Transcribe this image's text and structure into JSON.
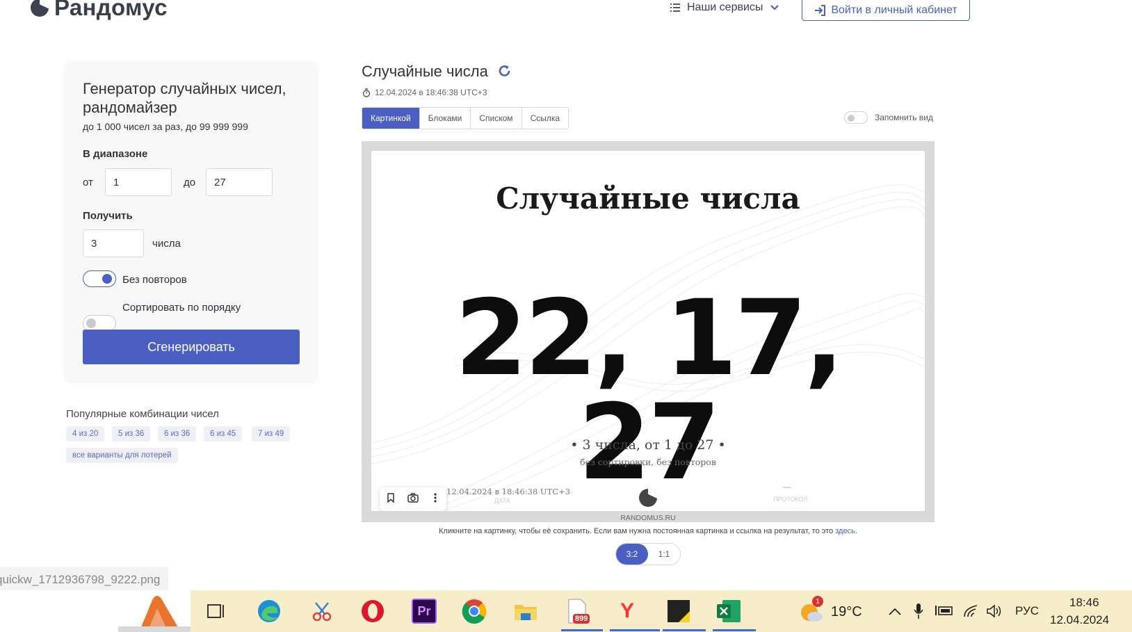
{
  "header": {
    "logo_text": "Рандомус",
    "services_label": "Наши сервисы",
    "login_label": "Войти в личный кабинет"
  },
  "generator": {
    "title": "Генератор случайных чисел, рандомайзер",
    "subtitle": "до 1 000 чисел за раз, до 99 999 999",
    "range_label": "В диапазоне",
    "from_label": "от",
    "from_value": "1",
    "to_label": "до",
    "to_value": "27",
    "get_label": "Получить",
    "count_value": "3",
    "count_unit": "числа",
    "no_repeat_label": "Без повторов",
    "no_repeat_on": true,
    "sort_label": "Сортировать по порядку",
    "sort_on": false,
    "generate_label": "Сгенерировать"
  },
  "popular": {
    "title": "Популярные комбинации чисел",
    "chips": [
      "4 из 20",
      "5 из 36",
      "6 из 36",
      "6 из 45",
      "7 из 49"
    ],
    "all_label": "все варианты для лотерей"
  },
  "result": {
    "title": "Случайные числа",
    "timestamp": "12.04.2024 в 18:46:38 UTC+3",
    "tabs": [
      "Картинкой",
      "Блоками",
      "Списком",
      "Ссылка"
    ],
    "active_tab": "Картинкой",
    "remember_label": "Запомнить вид",
    "image": {
      "title": "Случайные числа",
      "numbers": "22, 17, 27",
      "summary": "• 3 числа, от 1 до 27 •",
      "summary_sub": "без сортировки, без повторов",
      "footer_date": "12.04.2024 в 18:46:38 UTC+3",
      "footer_date_label": "ДАТА",
      "footer_protocol_dash": "—",
      "footer_protocol_label": "ПРОТОКОЛ",
      "site": "RANDOMUS.RU"
    },
    "hint_text": "Кликните на картинку, чтобы её сохранить. Если вам нужна постоянная картинка и ссылка на результат, то это ",
    "hint_link": "здесь",
    "hint_end": ".",
    "ratios": [
      "3:2",
      "1:1"
    ],
    "active_ratio": "3:2"
  },
  "download_bar": {
    "filename": "quickw_1712936798_9222.png"
  },
  "taskbar": {
    "apps": [
      "task-view",
      "edge",
      "snipping-tool",
      "opera",
      "premiere-pro",
      "chrome",
      "file-explorer",
      "pdf-document",
      "yandex-browser",
      "sticky-notes",
      "excel"
    ],
    "pdf_badge": "899",
    "weather_badge": "1",
    "weather_temp": "19°C",
    "lang": "РУС",
    "time": "18:46",
    "date": "12.04.2024",
    "colors": {
      "bar": "#f7edc8",
      "accent": "#4a5fc1"
    }
  }
}
